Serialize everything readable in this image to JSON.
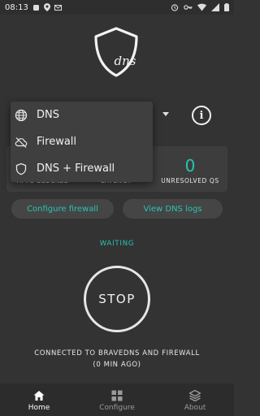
{
  "status_bar": {
    "time": "08:13",
    "icons": [
      "notification-icon",
      "location-icon",
      "gmail-icon",
      "alarm-icon",
      "vpn-key-icon",
      "wifi-icon",
      "signal-icon",
      "battery-icon"
    ]
  },
  "colors": {
    "background": "#333333",
    "accent": "#26c6b0",
    "card": "#3d3d3d",
    "menu": "#3f3f3f",
    "nav_bar": "#2c2c2c"
  },
  "mode_menu": {
    "items": [
      {
        "label": "DNS",
        "icon": "globe-icon"
      },
      {
        "label": "Firewall",
        "icon": "cloud-off-icon"
      },
      {
        "label": "DNS + Firewall",
        "icon": "shield-icon"
      }
    ]
  },
  "stats": {
    "resolved_value": "0",
    "resolved_label": "UNRESOLVED QS",
    "apps_blocked_label": "APPS BLOCKED",
    "latency_label": "LATENCY"
  },
  "buttons": {
    "configure_firewall": "Configure firewall",
    "view_dns_logs": "View DNS logs"
  },
  "status": "WAITING",
  "stop_label": "STOP",
  "connection": {
    "line1": "CONNECTED TO BRAVEDNS AND FIREWALL",
    "line2": "(0 MIN AGO)"
  },
  "nav": [
    {
      "label": "Home",
      "icon": "home-icon",
      "active": true
    },
    {
      "label": "Configure",
      "icon": "grid-icon",
      "active": false
    },
    {
      "label": "About",
      "icon": "layers-icon",
      "active": false
    }
  ]
}
